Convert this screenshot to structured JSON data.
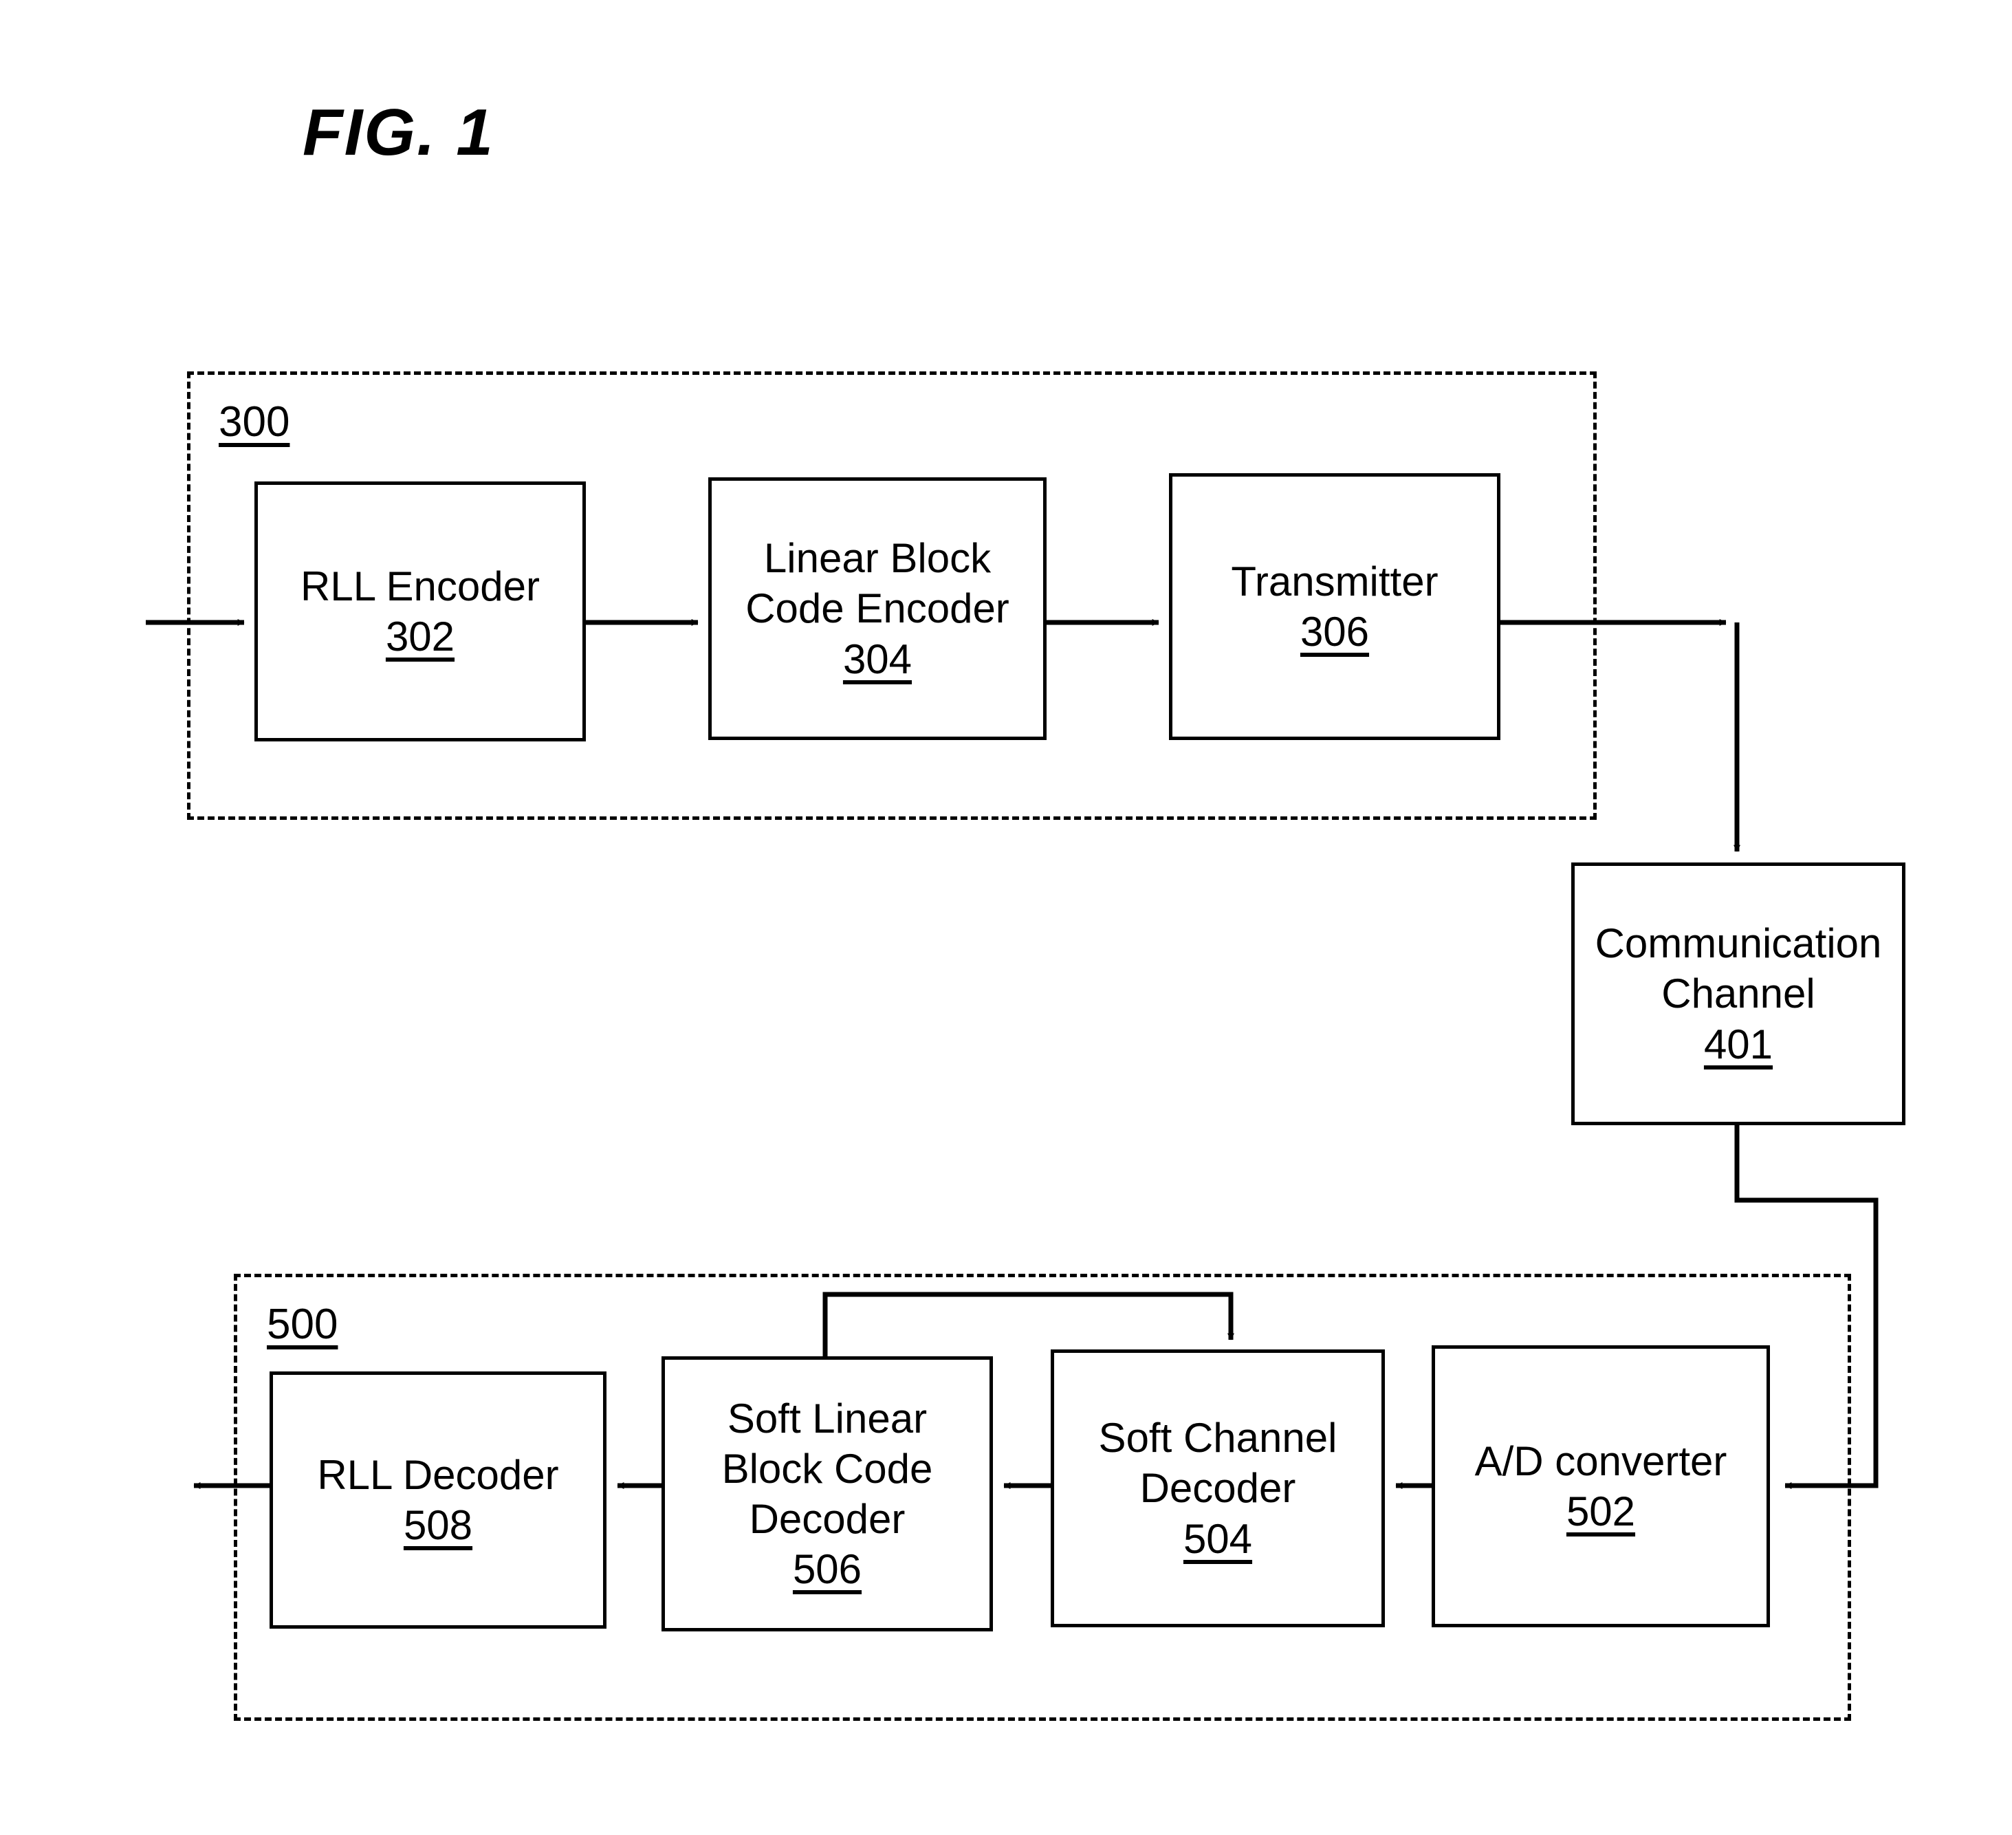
{
  "figure": {
    "title": "FIG. 1",
    "groups": [
      {
        "id": "300",
        "ref": "300",
        "role": "transmitter-system"
      },
      {
        "id": "500",
        "ref": "500",
        "role": "receiver-system"
      }
    ],
    "blocks": [
      {
        "id": "302",
        "title": "RLL Encoder",
        "ref": "302"
      },
      {
        "id": "304",
        "title": "Linear Block\nCode Encoder",
        "ref": "304"
      },
      {
        "id": "306",
        "title": "Transmitter",
        "ref": "306"
      },
      {
        "id": "401",
        "title": "Communication\nChannel",
        "ref": "401"
      },
      {
        "id": "502",
        "title": "A/D converter",
        "ref": "502"
      },
      {
        "id": "504",
        "title": "Soft Channel\nDecoder",
        "ref": "504"
      },
      {
        "id": "506",
        "title": "Soft Linear\nBlock Code\nDecoder",
        "ref": "506"
      },
      {
        "id": "508",
        "title": "RLL Decoder",
        "ref": "508"
      }
    ],
    "connections": [
      {
        "from": "input",
        "to": "302"
      },
      {
        "from": "302",
        "to": "304"
      },
      {
        "from": "304",
        "to": "306"
      },
      {
        "from": "306",
        "to": "401"
      },
      {
        "from": "401",
        "to": "502"
      },
      {
        "from": "502",
        "to": "504"
      },
      {
        "from": "504",
        "to": "506"
      },
      {
        "from": "506",
        "to": "508"
      },
      {
        "from": "508",
        "to": "output"
      },
      {
        "from": "506",
        "to": "504",
        "kind": "feedback"
      }
    ],
    "colors": {
      "ink": "#000000",
      "paper": "#ffffff"
    }
  }
}
